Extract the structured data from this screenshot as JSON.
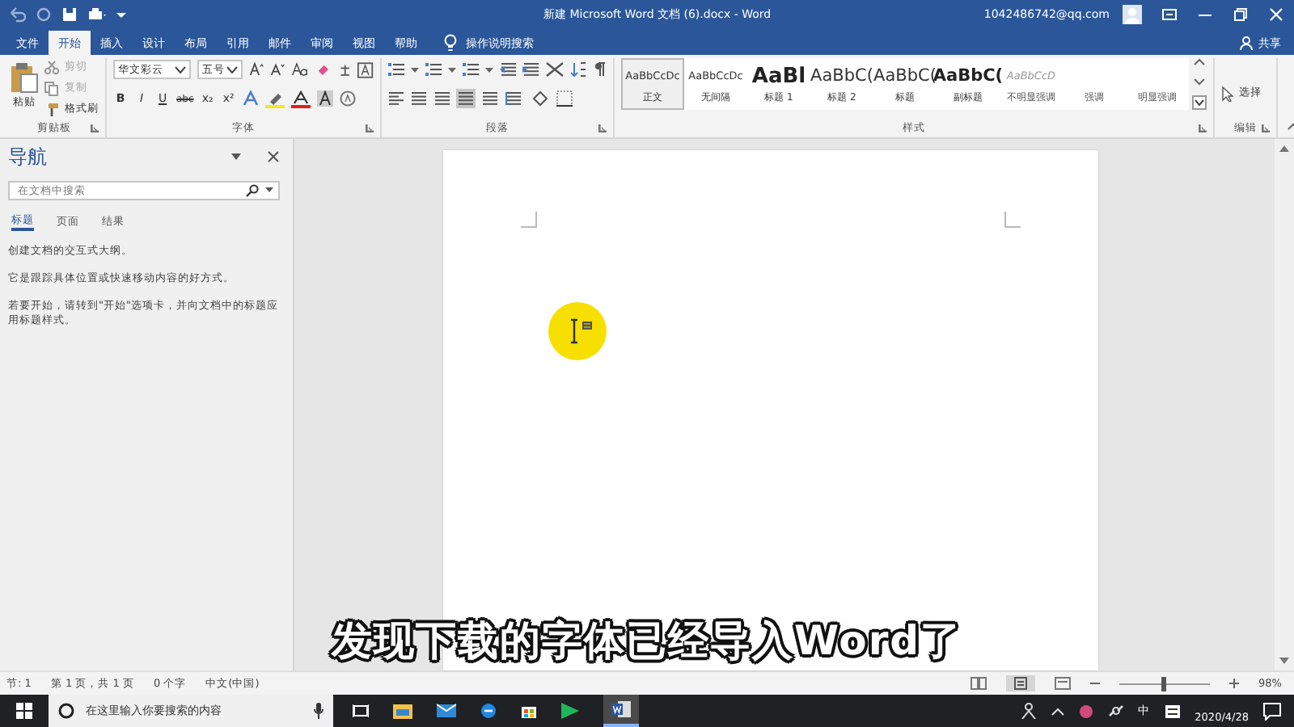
{
  "window": {
    "title": "新建 Microsoft Word 文档 (6).docx - Word",
    "user": "1042486742@qq.com"
  },
  "tabs": [
    {
      "label": "文件",
      "selected": false
    },
    {
      "label": "开始",
      "selected": true
    },
    {
      "label": "插入",
      "selected": false
    },
    {
      "label": "设计",
      "selected": false
    },
    {
      "label": "布局",
      "selected": false
    },
    {
      "label": "引用",
      "selected": false
    },
    {
      "label": "邮件",
      "selected": false
    },
    {
      "label": "审阅",
      "selected": false
    },
    {
      "label": "视图",
      "selected": false
    },
    {
      "label": "帮助",
      "selected": false
    }
  ],
  "tell_me": "操作说明搜索",
  "share": "共享",
  "ribbon": {
    "clipboard": {
      "label": "剪贴板",
      "paste": "粘贴",
      "cut": "剪切",
      "copy": "复制",
      "format_painter": "格式刷"
    },
    "font": {
      "label": "字体",
      "name": "华文彩云",
      "size": "五号",
      "format_buttons": [
        "B",
        "I",
        "U",
        "abc",
        "x₂",
        "x²"
      ]
    },
    "paragraph": {
      "label": "段落"
    },
    "styles": {
      "label": "样式",
      "items": [
        {
          "preview": "AaBbCcDc",
          "label": "正文",
          "selected": true,
          "kind": "normal"
        },
        {
          "preview": "AaBbCcDc",
          "label": "无间隔",
          "selected": false,
          "kind": "normal"
        },
        {
          "preview": "AaBl",
          "label": "标题 1",
          "selected": false,
          "kind": "heading1"
        },
        {
          "preview": "AaBbC(",
          "label": "标题 2",
          "selected": false,
          "kind": "heading2"
        },
        {
          "preview": "AaBbC(",
          "label": "标题",
          "selected": false,
          "kind": "heading2"
        },
        {
          "preview": "AaBbC(",
          "label": "副标题",
          "selected": false,
          "kind": "subtitle"
        },
        {
          "preview": "AaBbCcD",
          "label": "不明显强调",
          "selected": false,
          "kind": "emphasis"
        },
        {
          "label": "强调",
          "selected": false,
          "kind": "emphasis"
        },
        {
          "label": "明显强调",
          "selected": false,
          "kind": "emphasis"
        }
      ]
    },
    "editing": {
      "label": "编辑",
      "select": "选择"
    }
  },
  "navigation": {
    "title": "导航",
    "search": {
      "placeholder": "在文档中搜索"
    },
    "tabs": [
      {
        "label": "标题",
        "selected": true
      },
      {
        "label": "页面",
        "selected": false
      },
      {
        "label": "结果",
        "selected": false
      }
    ],
    "paragraphs": [
      "创建文档的交互式大纲。",
      "它是跟踪具体位置或快速移动内容的好方式。",
      "若要开始，请转到\"开始\"选项卡，并向文档中的标题应用标题样式。"
    ]
  },
  "caption": "发现下载的字体已经导入Word了",
  "status_bar": {
    "items": [
      "节: 1",
      "第 1 页，共 1 页",
      "0 个字",
      "中文(中国)"
    ],
    "zoom": {
      "level": 0.48,
      "reading": "98%"
    }
  },
  "taskbar": {
    "search": {
      "placeholder": "在这里输入你要搜索的内容"
    },
    "ime": "中",
    "date": "2020/4/28"
  }
}
